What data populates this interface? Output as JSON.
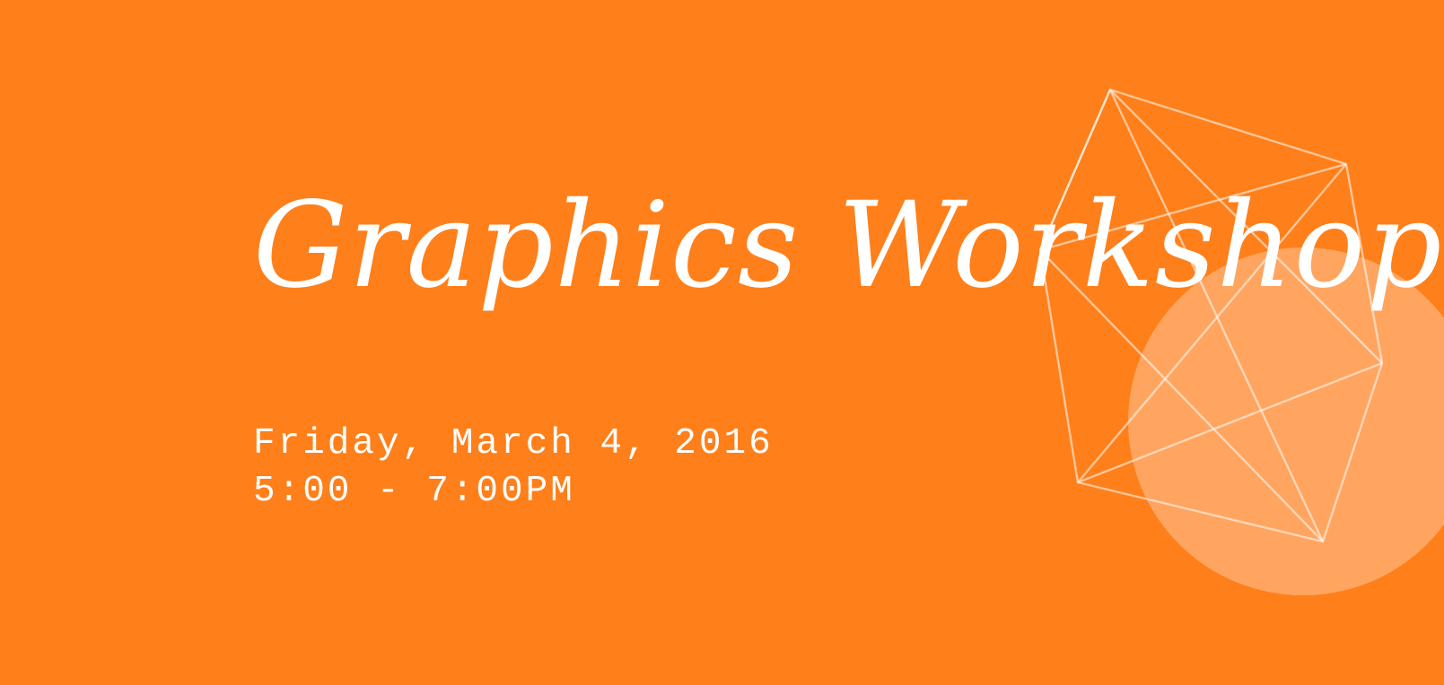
{
  "event": {
    "title": "Graphics Workshop",
    "date": "Friday, March 4, 2016",
    "time": "5:00 - 7:00PM"
  },
  "colors": {
    "background": "#ff7f1a",
    "text": "#ffffff",
    "circle": "rgba(255,255,255,0.30)",
    "wireframe": "rgba(255,255,255,0.55)"
  },
  "decoration": {
    "shape": "geometric-wireframe-polyhedron",
    "accent": "translucent-circle"
  }
}
